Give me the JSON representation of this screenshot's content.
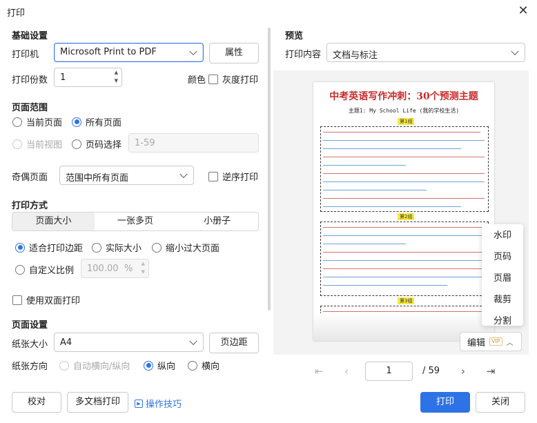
{
  "window": {
    "title": "打印"
  },
  "basic": {
    "heading": "基础设置",
    "printer_label": "打印机",
    "printer_value": "Microsoft Print to PDF",
    "properties_button": "属性",
    "copies_label": "打印份数",
    "copies_value": "1",
    "color_label": "颜色",
    "grayscale_label": "灰度打印"
  },
  "range": {
    "heading": "页面范围",
    "current_page": "当前页面",
    "all_pages": "所有页面",
    "current_view": "当前视图",
    "page_select": "页码选择",
    "page_select_placeholder": "1-59",
    "odd_even_label": "奇偶页面",
    "odd_even_value": "范围中所有页面",
    "reverse_label": "逆序打印"
  },
  "mode": {
    "heading": "打印方式",
    "tabs": [
      "页面大小",
      "一张多页",
      "小册子"
    ],
    "fit_margins": "适合打印边距",
    "actual_size": "实际大小",
    "shrink_large": "缩小过大页面",
    "custom_scale": "自定义比例",
    "scale_value": "100.00",
    "scale_unit": "%",
    "duplex_label": "使用双面打印"
  },
  "page_setup": {
    "heading": "页面设置",
    "paper_size_label": "纸张大小",
    "paper_size_value": "A4",
    "margins_button": "页边距",
    "orientation_label": "纸张方向",
    "auto_orientation": "自动横向/纵向",
    "portrait": "纵向",
    "landscape": "横向"
  },
  "footer": {
    "proof_button": "校对",
    "multi_doc_button": "多文档打印",
    "tips_link": "操作技巧",
    "print_button": "打印",
    "close_button": "关闭"
  },
  "preview": {
    "heading": "预览",
    "content_label": "打印内容",
    "content_value": "文档与标注",
    "doc_title": "中考英语写作冲刺：30个预测主题",
    "doc_subtitle": "主题1: My School Life (我的学校生活)",
    "group1": "第1组",
    "group2": "第2组",
    "group3": "第3组",
    "page_current": "1",
    "page_total": "/ 59",
    "edit_button": "编辑",
    "vip_badge": "VIP"
  },
  "edit_menu": [
    "水印",
    "页码",
    "页眉",
    "裁剪",
    "分割"
  ],
  "colors": {
    "accent": "#2e73e6",
    "title_red": "#c92b2b",
    "highlight": "#f7e840"
  }
}
